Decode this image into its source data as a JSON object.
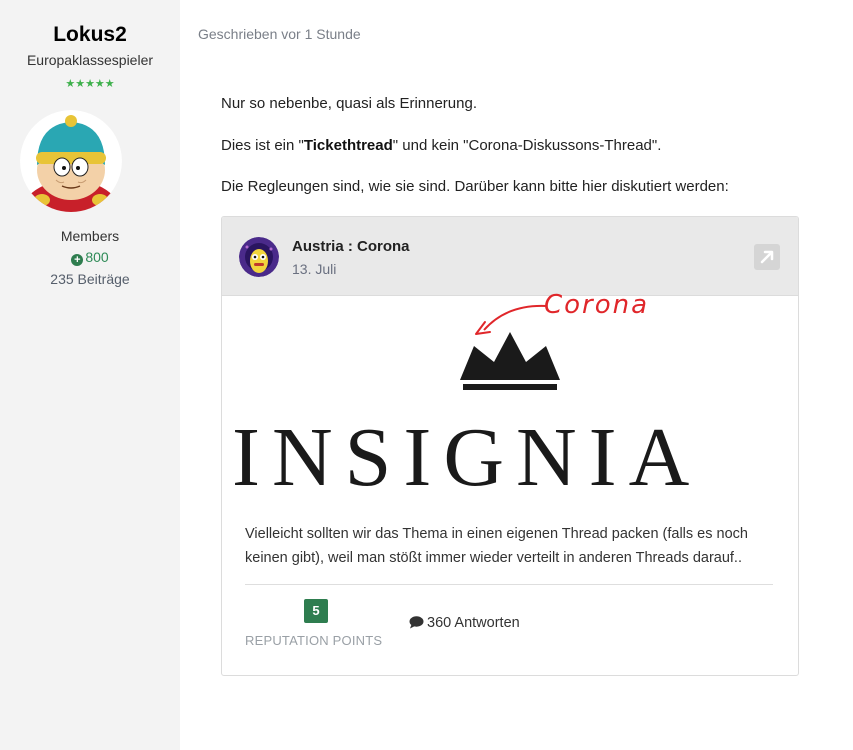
{
  "author": {
    "name": "Lokus2",
    "title": "Europaklassespieler",
    "stars": "★★★★★",
    "group": "Members",
    "reputation": "800",
    "posts": "235 Beiträge",
    "avatar_icon": "cartman-avatar-icon"
  },
  "post": {
    "meta": "Geschrieben vor 1 Stunde",
    "line1": "Nur so nebenbe, quasi als Erinnerung.",
    "line2_pre": "Dies ist ein \"",
    "line2_bold": "Tickethtread",
    "line2_post": "\" und kein \"Corona-Diskussons-Thread\".",
    "line3": "Die Regleungen sind, wie sie sind. Darüber kann bitte hier diskutiert werden:"
  },
  "embed": {
    "title": "Austria : Corona",
    "date": "13. Juli",
    "image_word": "INSIGNIA",
    "image_annotation": "Corona",
    "excerpt": "Vielleicht sollten wir das Thema in einen eigenen Thread packen (falls es noch keinen gibt), weil man stößt immer wieder verteilt in anderen Threads darauf..",
    "reputation_value": "5",
    "reputation_label": "REPUTATION POINTS",
    "replies": "360 Antworten",
    "open_icon": "external-link-icon",
    "replies_icon": "comment-bubble-icon"
  },
  "colors": {
    "sidebar_bg": "#f3f3f3",
    "rep_green": "#2e7d4f",
    "stars_green": "#3db04b",
    "annotation_red": "#e0262a"
  }
}
